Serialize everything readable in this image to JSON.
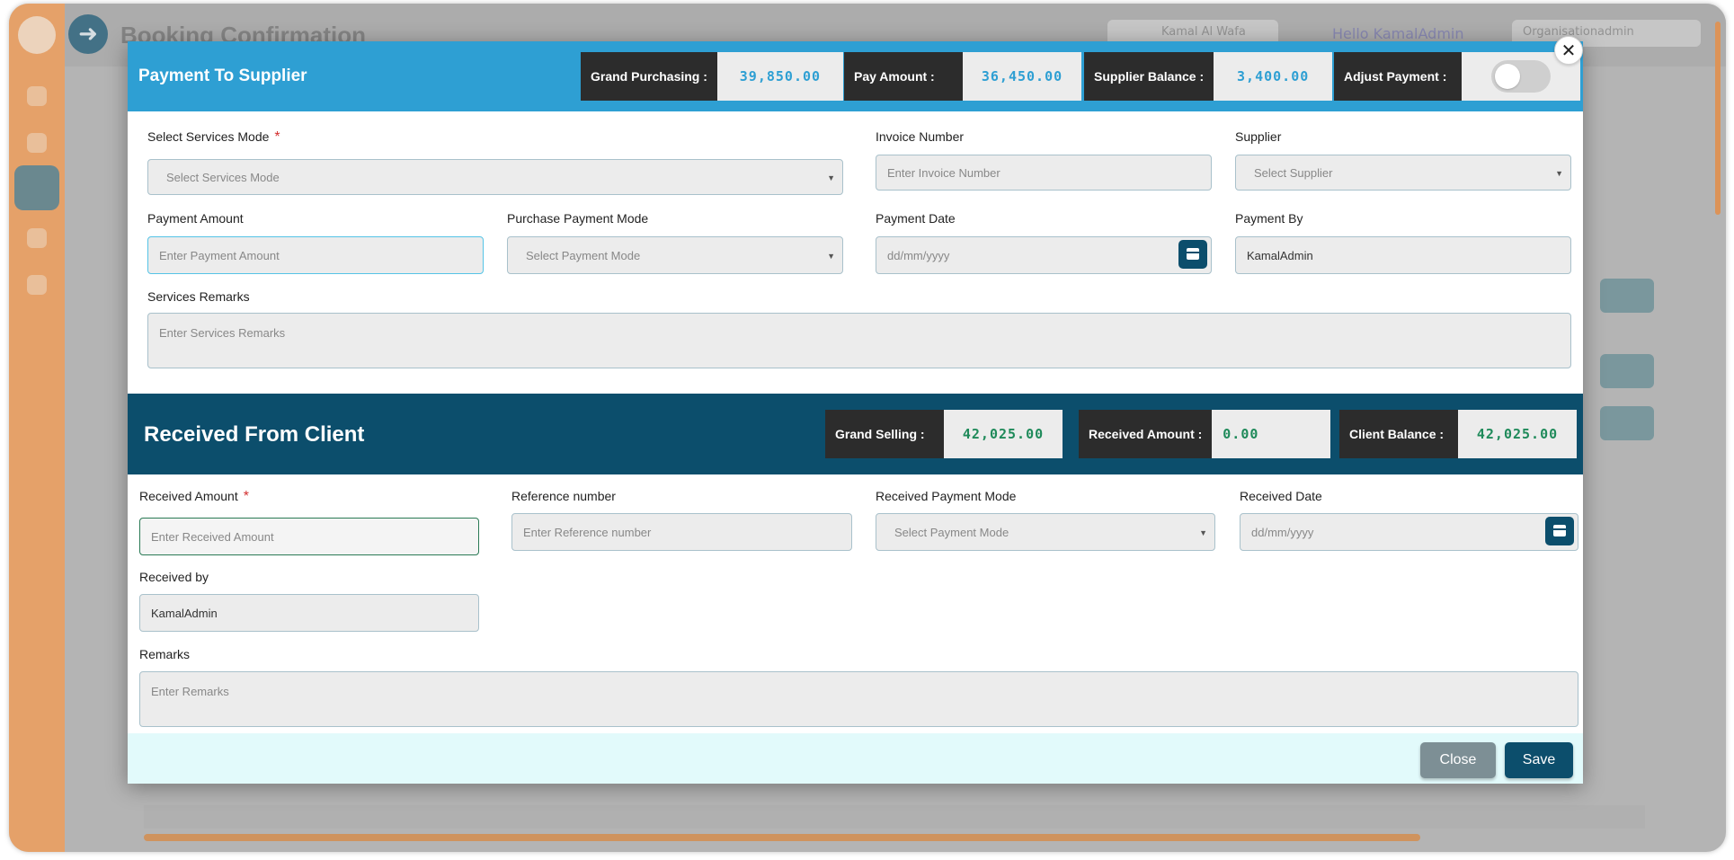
{
  "app": {
    "title": "Booking Confirmation",
    "header_pill": "Kamal Al Wafa",
    "greeting": "Hello KamalAdmin",
    "role_pill": "Organisationadmin"
  },
  "supplier_section": {
    "title": "Payment To Supplier",
    "grand_purchasing_label": "Grand Purchasing :",
    "grand_purchasing_value": "39,850.00",
    "pay_amount_label": "Pay Amount :",
    "pay_amount_value": "36,450.00",
    "supplier_balance_label": "Supplier Balance :",
    "supplier_balance_value": "3,400.00",
    "adjust_payment_label": "Adjust Payment :",
    "adjust_payment_on": false,
    "services_mode_label": "Select Services Mode",
    "services_mode_placeholder": "Select Services Mode",
    "invoice_label": "Invoice Number",
    "invoice_placeholder": "Enter Invoice Number",
    "supplier_label": "Supplier",
    "supplier_placeholder": "Select Supplier",
    "payment_amount_label": "Payment Amount",
    "payment_amount_placeholder": "Enter  Payment Amount",
    "purchase_mode_label": "Purchase Payment Mode",
    "purchase_mode_placeholder": "Select Payment Mode",
    "payment_date_label": "Payment Date",
    "payment_date_placeholder": "dd/mm/yyyy",
    "payment_by_label": "Payment By",
    "payment_by_value": "KamalAdmin",
    "remarks_label": "Services Remarks",
    "remarks_placeholder": "Enter Services Remarks"
  },
  "client_section": {
    "title": "Received From Client",
    "grand_selling_label": "Grand Selling :",
    "grand_selling_value": "42,025.00",
    "received_amount_label": "Received Amount :",
    "received_amount_value": "0.00",
    "client_balance_label": "Client Balance :",
    "client_balance_value": "42,025.00",
    "received_amount_field_label": "Received Amount",
    "received_amount_placeholder": "Enter  Received Amount",
    "reference_label": "Reference number",
    "reference_placeholder": "Enter Reference number",
    "received_mode_label": "Received Payment Mode",
    "received_mode_placeholder": "Select Payment Mode",
    "received_date_label": "Received Date",
    "received_date_placeholder": "dd/mm/yyyy",
    "received_by_label": "Received by",
    "received_by_value": "KamalAdmin",
    "remarks_label": "Remarks",
    "remarks_placeholder": "Enter Remarks"
  },
  "footer": {
    "close_label": "Close",
    "save_label": "Save"
  },
  "icons": {
    "close": "close-icon",
    "calendar": "calendar-icon",
    "caret": "chevron-down-icon"
  },
  "colors": {
    "supplier_header": "#2e9fd3",
    "client_header": "#0c4e6c",
    "sidebar": "#efa86e",
    "save_button": "#0c4e6c",
    "close_button": "#7d8f95"
  }
}
